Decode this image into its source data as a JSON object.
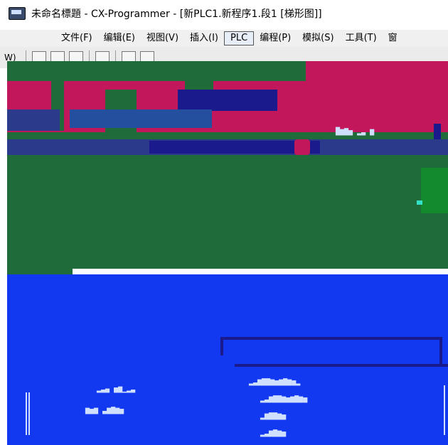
{
  "window": {
    "title": "未命名標題 - CX-Programmer - [新PLC1.新程序1.段1 [梯形图]]"
  },
  "menu": {
    "items": [
      {
        "name": "menu-file",
        "label": "文件(F)"
      },
      {
        "name": "menu-edit",
        "label": "编辑(E)"
      },
      {
        "name": "menu-view",
        "label": "视图(V)"
      },
      {
        "name": "menu-insert",
        "label": "插入(I)"
      },
      {
        "name": "menu-plc",
        "label": "PLC"
      },
      {
        "name": "menu-program",
        "label": "编程(P)"
      },
      {
        "name": "menu-simulate",
        "label": "模拟(S)"
      },
      {
        "name": "menu-tools",
        "label": "工具(T)"
      },
      {
        "name": "menu-more",
        "label": "窗"
      }
    ],
    "selected": "PLC"
  },
  "toolbar": {
    "left_fragment": "W)"
  },
  "colors": {
    "crimson": "#c2185b",
    "green": "#1f6b3a",
    "blue": "#1238f0",
    "navy": "#1a1a8c",
    "accent_cyan": "#35e0c8"
  }
}
